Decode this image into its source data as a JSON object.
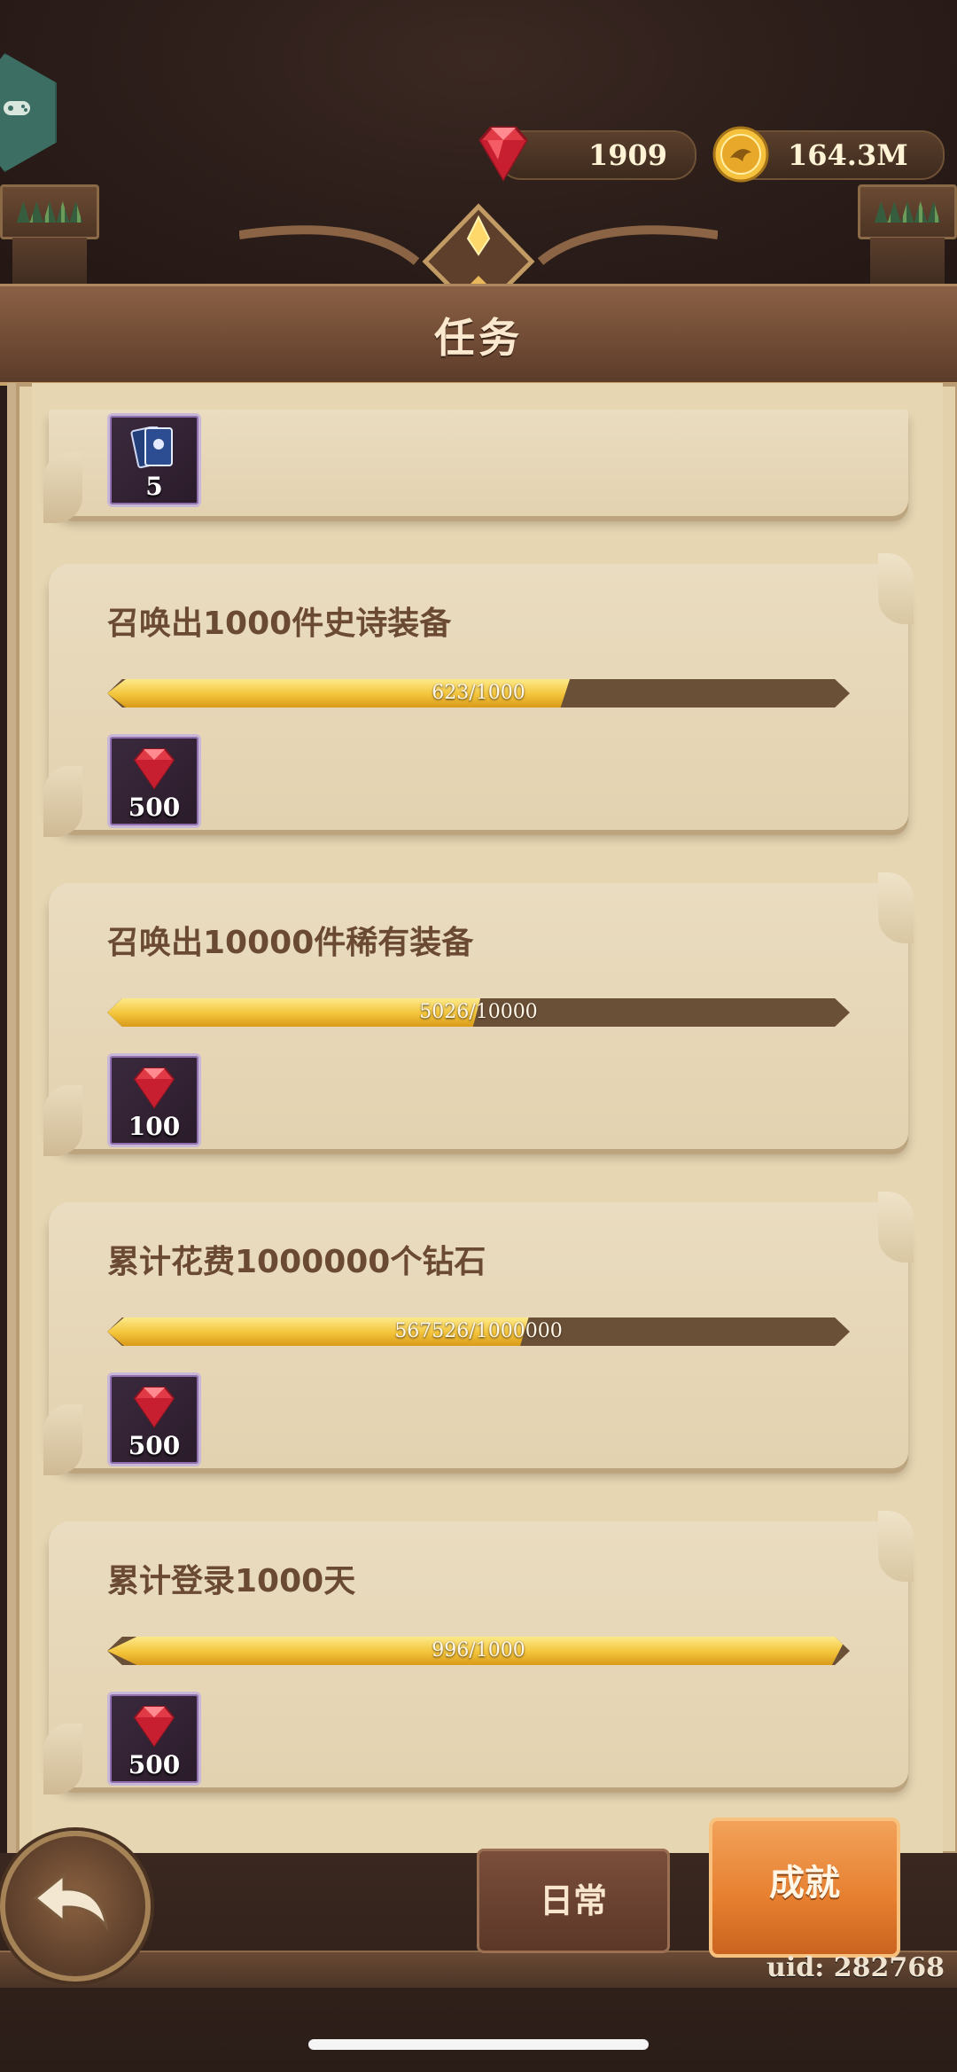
{
  "header": {
    "gems": "1909",
    "gold": "164.3M",
    "title": "任务"
  },
  "tasks": [
    {
      "title": "",
      "reward_label": "5",
      "reward_icon": "card-pack-icon"
    },
    {
      "title": "召唤出1000件史诗装备",
      "progress_text": "623/1000",
      "progress_fraction": 0.623,
      "reward_label": "500",
      "reward_icon": "ruby-icon"
    },
    {
      "title": "召唤出10000件稀有装备",
      "progress_text": "5026/10000",
      "progress_fraction": 0.5026,
      "reward_label": "100",
      "reward_icon": "ruby-icon"
    },
    {
      "title": "累计花费1000000个钻石",
      "progress_text": "567526/1000000",
      "progress_fraction": 0.567526,
      "reward_label": "500",
      "reward_icon": "ruby-icon"
    },
    {
      "title": "累计登录1000天",
      "progress_text": "996/1000",
      "progress_fraction": 0.996,
      "reward_label": "500",
      "reward_icon": "ruby-icon"
    }
  ],
  "bottom": {
    "tab_daily": "日常",
    "tab_achievement": "成就",
    "uid": "uid: 282768"
  },
  "colors": {
    "accent_orange": "#e67e2e",
    "progress_gold": "#f3c43a",
    "title_brown": "#6b4a33"
  }
}
